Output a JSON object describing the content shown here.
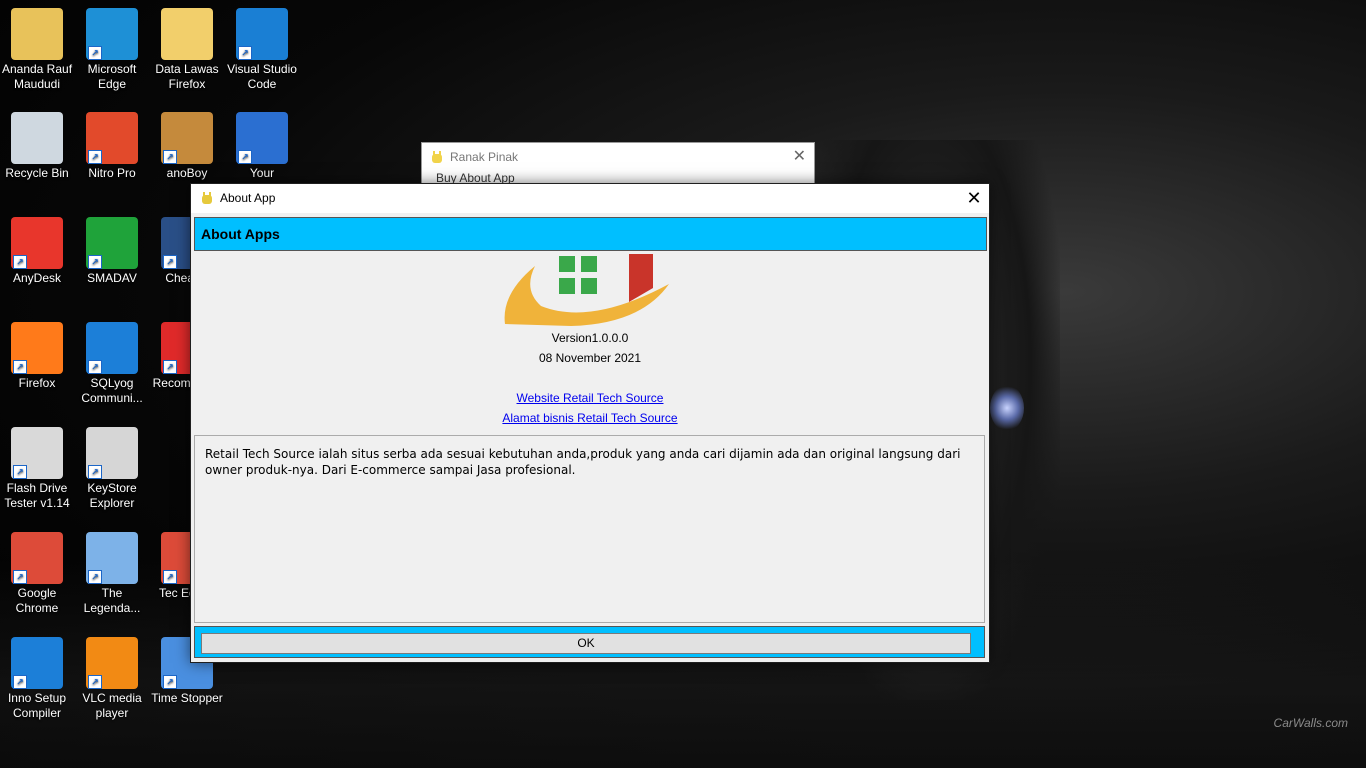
{
  "desktop": {
    "icons": [
      {
        "label": "Ananda Rauf Maududi",
        "icon": "user-folder-icon",
        "color": "#e8c25a"
      },
      {
        "label": "Microsoft Edge",
        "icon": "edge-icon",
        "color": "#1e90d6"
      },
      {
        "label": "Data Lawas Firefox",
        "icon": "folder-icon",
        "color": "#f2cf6b"
      },
      {
        "label": "Visual Studio Code",
        "icon": "vscode-icon",
        "color": "#1a7fd4"
      },
      {
        "label": "Recycle Bin",
        "icon": "recycle-bin-icon",
        "color": "#cfd8e0"
      },
      {
        "label": "Nitro Pro",
        "icon": "nitro-icon",
        "color": "#e24a2b"
      },
      {
        "label": "anoBoy",
        "icon": "anoboy-icon",
        "color": "#c58a3c"
      },
      {
        "label": "Your",
        "icon": "yu-icon",
        "color": "#2b6fd1"
      },
      {
        "label": "AnyDesk",
        "icon": "anydesk-icon",
        "color": "#e8362c"
      },
      {
        "label": "SMADAV",
        "icon": "smadav-icon",
        "color": "#1fa33a"
      },
      {
        "label": "Cheat E",
        "icon": "cheat-engine-icon",
        "color": "#2a4f87"
      },
      {
        "label": "Firefox",
        "icon": "firefox-icon",
        "color": "#ff7a1a"
      },
      {
        "label": "SQLyog Communi...",
        "icon": "sqlyog-icon",
        "color": "#1c7fd8"
      },
      {
        "label": "Recom Softv",
        "icon": "heart-icon",
        "color": "#e02a2a"
      },
      {
        "label": "Flash Drive Tester v1.14",
        "icon": "usb-drive-icon",
        "color": "#d9d9d9"
      },
      {
        "label": "KeyStore Explorer",
        "icon": "keystore-icon",
        "color": "#d6d6d6"
      },
      {
        "label": "Google Chrome",
        "icon": "chrome-icon",
        "color": "#dd4b39"
      },
      {
        "label": "The Legenda...",
        "icon": "sword-icon",
        "color": "#7db2e8"
      },
      {
        "label": "Tec Educa",
        "icon": "chrome-icon",
        "color": "#dd4b39"
      },
      {
        "label": "Inno Setup Compiler",
        "icon": "inno-setup-icon",
        "color": "#1c7fd8"
      },
      {
        "label": "VLC media player",
        "icon": "vlc-icon",
        "color": "#f28a14"
      },
      {
        "label": "Time Stopper",
        "icon": "clock-icon",
        "color": "#4a8fe0"
      }
    ],
    "watermark": "CarWalls.com"
  },
  "background_window": {
    "title": "Ranak Pinak",
    "menu": "Buy   About App"
  },
  "dialog": {
    "title": "About App",
    "header": "About Apps",
    "version": "Version1.0.0.0",
    "date": "08 November 2021",
    "link1": "Website Retail Tech Source",
    "link2": "Alamat bisnis Retail Tech Source",
    "description": "Retail Tech Source ialah situs serba ada sesuai kebutuhan anda,produk yang anda cari dijamin ada dan original langsung dari owner produk-nya. Dari E-commerce sampai Jasa profesional.",
    "ok_label": "OK",
    "accent": "#00bfff"
  }
}
